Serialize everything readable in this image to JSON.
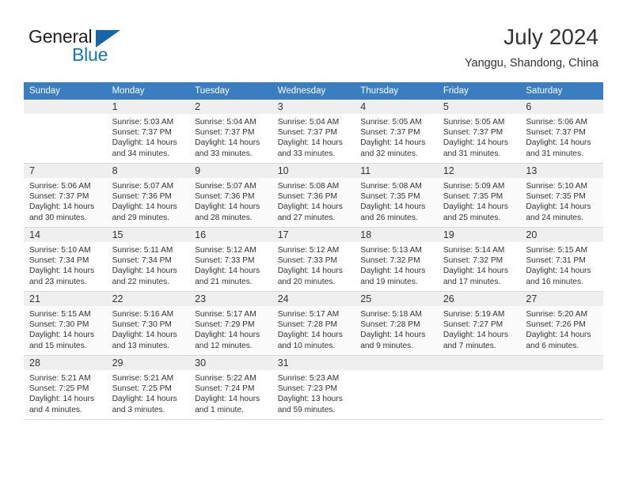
{
  "brand": {
    "line1": "General",
    "line2": "Blue",
    "triangle_color": "#1565a8",
    "blue_color": "#1278be"
  },
  "header": {
    "title": "July 2024",
    "subtitle": "Yanggu, Shandong, China",
    "accent_color": "#3a7ec1"
  },
  "weekday_headers": [
    "Sunday",
    "Monday",
    "Tuesday",
    "Wednesday",
    "Thursday",
    "Friday",
    "Saturday"
  ],
  "labels": {
    "sunrise_prefix": "Sunrise:",
    "sunset_prefix": "Sunset:",
    "daylight_prefix": "Daylight:"
  },
  "weeks": [
    {
      "days": [
        {
          "num": "",
          "sunrise": "",
          "sunset": "",
          "daylight": "",
          "empty": true
        },
        {
          "num": "1",
          "sunrise": "Sunrise: 5:03 AM",
          "sunset": "Sunset: 7:37 PM",
          "daylight": "Daylight: 14 hours and 34 minutes.",
          "empty": false
        },
        {
          "num": "2",
          "sunrise": "Sunrise: 5:04 AM",
          "sunset": "Sunset: 7:37 PM",
          "daylight": "Daylight: 14 hours and 33 minutes.",
          "empty": false
        },
        {
          "num": "3",
          "sunrise": "Sunrise: 5:04 AM",
          "sunset": "Sunset: 7:37 PM",
          "daylight": "Daylight: 14 hours and 33 minutes.",
          "empty": false
        },
        {
          "num": "4",
          "sunrise": "Sunrise: 5:05 AM",
          "sunset": "Sunset: 7:37 PM",
          "daylight": "Daylight: 14 hours and 32 minutes.",
          "empty": false
        },
        {
          "num": "5",
          "sunrise": "Sunrise: 5:05 AM",
          "sunset": "Sunset: 7:37 PM",
          "daylight": "Daylight: 14 hours and 31 minutes.",
          "empty": false
        },
        {
          "num": "6",
          "sunrise": "Sunrise: 5:06 AM",
          "sunset": "Sunset: 7:37 PM",
          "daylight": "Daylight: 14 hours and 31 minutes.",
          "empty": false
        }
      ]
    },
    {
      "days": [
        {
          "num": "7",
          "sunrise": "Sunrise: 5:06 AM",
          "sunset": "Sunset: 7:37 PM",
          "daylight": "Daylight: 14 hours and 30 minutes.",
          "empty": false
        },
        {
          "num": "8",
          "sunrise": "Sunrise: 5:07 AM",
          "sunset": "Sunset: 7:36 PM",
          "daylight": "Daylight: 14 hours and 29 minutes.",
          "empty": false
        },
        {
          "num": "9",
          "sunrise": "Sunrise: 5:07 AM",
          "sunset": "Sunset: 7:36 PM",
          "daylight": "Daylight: 14 hours and 28 minutes.",
          "empty": false
        },
        {
          "num": "10",
          "sunrise": "Sunrise: 5:08 AM",
          "sunset": "Sunset: 7:36 PM",
          "daylight": "Daylight: 14 hours and 27 minutes.",
          "empty": false
        },
        {
          "num": "11",
          "sunrise": "Sunrise: 5:08 AM",
          "sunset": "Sunset: 7:35 PM",
          "daylight": "Daylight: 14 hours and 26 minutes.",
          "empty": false
        },
        {
          "num": "12",
          "sunrise": "Sunrise: 5:09 AM",
          "sunset": "Sunset: 7:35 PM",
          "daylight": "Daylight: 14 hours and 25 minutes.",
          "empty": false
        },
        {
          "num": "13",
          "sunrise": "Sunrise: 5:10 AM",
          "sunset": "Sunset: 7:35 PM",
          "daylight": "Daylight: 14 hours and 24 minutes.",
          "empty": false
        }
      ]
    },
    {
      "days": [
        {
          "num": "14",
          "sunrise": "Sunrise: 5:10 AM",
          "sunset": "Sunset: 7:34 PM",
          "daylight": "Daylight: 14 hours and 23 minutes.",
          "empty": false
        },
        {
          "num": "15",
          "sunrise": "Sunrise: 5:11 AM",
          "sunset": "Sunset: 7:34 PM",
          "daylight": "Daylight: 14 hours and 22 minutes.",
          "empty": false
        },
        {
          "num": "16",
          "sunrise": "Sunrise: 5:12 AM",
          "sunset": "Sunset: 7:33 PM",
          "daylight": "Daylight: 14 hours and 21 minutes.",
          "empty": false
        },
        {
          "num": "17",
          "sunrise": "Sunrise: 5:12 AM",
          "sunset": "Sunset: 7:33 PM",
          "daylight": "Daylight: 14 hours and 20 minutes.",
          "empty": false
        },
        {
          "num": "18",
          "sunrise": "Sunrise: 5:13 AM",
          "sunset": "Sunset: 7:32 PM",
          "daylight": "Daylight: 14 hours and 19 minutes.",
          "empty": false
        },
        {
          "num": "19",
          "sunrise": "Sunrise: 5:14 AM",
          "sunset": "Sunset: 7:32 PM",
          "daylight": "Daylight: 14 hours and 17 minutes.",
          "empty": false
        },
        {
          "num": "20",
          "sunrise": "Sunrise: 5:15 AM",
          "sunset": "Sunset: 7:31 PM",
          "daylight": "Daylight: 14 hours and 16 minutes.",
          "empty": false
        }
      ]
    },
    {
      "days": [
        {
          "num": "21",
          "sunrise": "Sunrise: 5:15 AM",
          "sunset": "Sunset: 7:30 PM",
          "daylight": "Daylight: 14 hours and 15 minutes.",
          "empty": false
        },
        {
          "num": "22",
          "sunrise": "Sunrise: 5:16 AM",
          "sunset": "Sunset: 7:30 PM",
          "daylight": "Daylight: 14 hours and 13 minutes.",
          "empty": false
        },
        {
          "num": "23",
          "sunrise": "Sunrise: 5:17 AM",
          "sunset": "Sunset: 7:29 PM",
          "daylight": "Daylight: 14 hours and 12 minutes.",
          "empty": false
        },
        {
          "num": "24",
          "sunrise": "Sunrise: 5:17 AM",
          "sunset": "Sunset: 7:28 PM",
          "daylight": "Daylight: 14 hours and 10 minutes.",
          "empty": false
        },
        {
          "num": "25",
          "sunrise": "Sunrise: 5:18 AM",
          "sunset": "Sunset: 7:28 PM",
          "daylight": "Daylight: 14 hours and 9 minutes.",
          "empty": false
        },
        {
          "num": "26",
          "sunrise": "Sunrise: 5:19 AM",
          "sunset": "Sunset: 7:27 PM",
          "daylight": "Daylight: 14 hours and 7 minutes.",
          "empty": false
        },
        {
          "num": "27",
          "sunrise": "Sunrise: 5:20 AM",
          "sunset": "Sunset: 7:26 PM",
          "daylight": "Daylight: 14 hours and 6 minutes.",
          "empty": false
        }
      ]
    },
    {
      "days": [
        {
          "num": "28",
          "sunrise": "Sunrise: 5:21 AM",
          "sunset": "Sunset: 7:25 PM",
          "daylight": "Daylight: 14 hours and 4 minutes.",
          "empty": false
        },
        {
          "num": "29",
          "sunrise": "Sunrise: 5:21 AM",
          "sunset": "Sunset: 7:25 PM",
          "daylight": "Daylight: 14 hours and 3 minutes.",
          "empty": false
        },
        {
          "num": "30",
          "sunrise": "Sunrise: 5:22 AM",
          "sunset": "Sunset: 7:24 PM",
          "daylight": "Daylight: 14 hours and 1 minute.",
          "empty": false
        },
        {
          "num": "31",
          "sunrise": "Sunrise: 5:23 AM",
          "sunset": "Sunset: 7:23 PM",
          "daylight": "Daylight: 13 hours and 59 minutes.",
          "empty": false
        },
        {
          "num": "",
          "sunrise": "",
          "sunset": "",
          "daylight": "",
          "empty": true
        },
        {
          "num": "",
          "sunrise": "",
          "sunset": "",
          "daylight": "",
          "empty": true
        },
        {
          "num": "",
          "sunrise": "",
          "sunset": "",
          "daylight": "",
          "empty": true
        }
      ]
    }
  ]
}
